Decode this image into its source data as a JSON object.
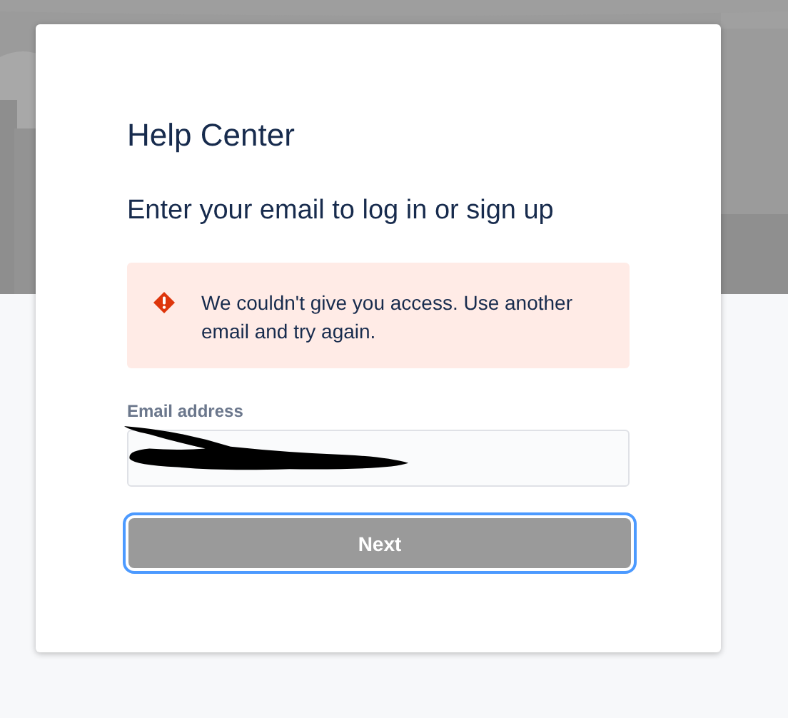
{
  "card": {
    "title": "Help Center",
    "subtitle": "Enter your email to log in or sign up"
  },
  "error": {
    "message": "We couldn't give you access. Use another email and try again."
  },
  "email_field": {
    "label": "Email address",
    "redacted": true
  },
  "next_button": {
    "label": "Next",
    "disabled": true,
    "focused": true
  }
}
